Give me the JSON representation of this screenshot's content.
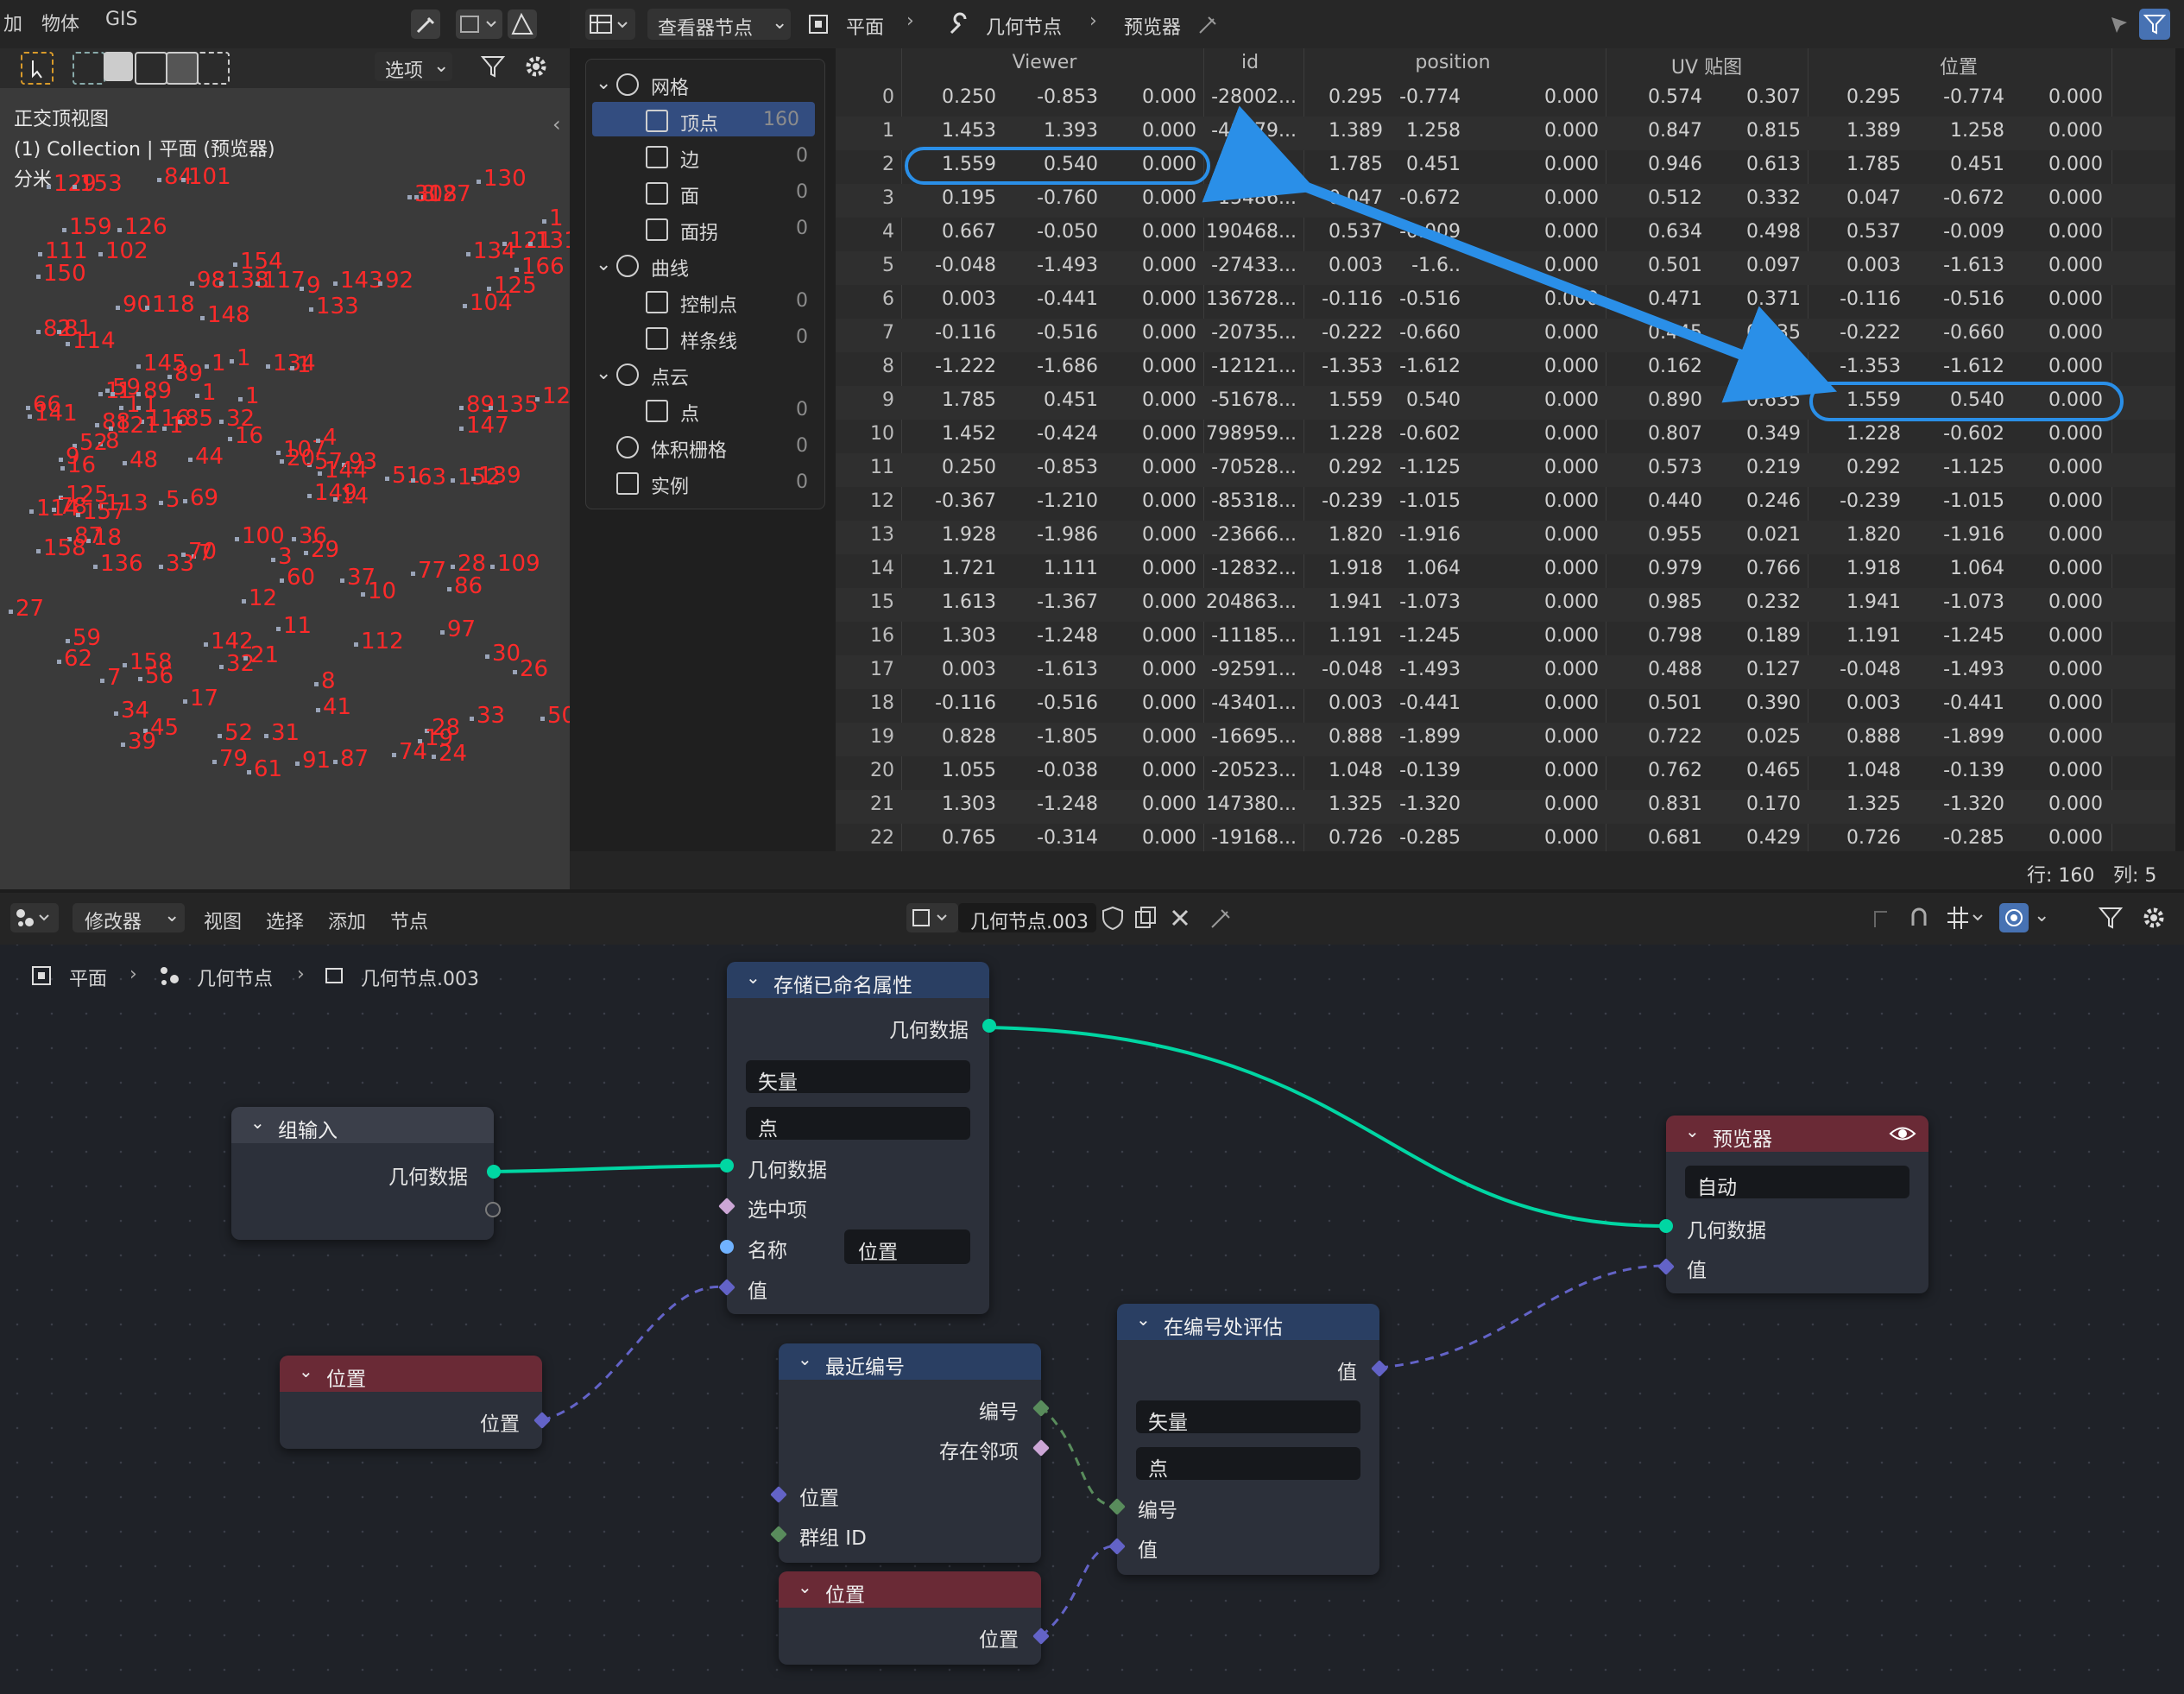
{
  "viewport": {
    "menu": [
      "加",
      "物体",
      "GIS"
    ],
    "options_label": "选项",
    "view_name": "正交顶视图",
    "collection_line": "(1) Collection | 平面 (预览器)",
    "units": "分米",
    "point_labels": [
      "129",
      "153",
      "84",
      "101",
      "130",
      "127",
      "8",
      "308",
      "1",
      "159",
      "126",
      "111",
      "102",
      "134",
      "121",
      "131",
      "150",
      "154",
      "166",
      "98",
      "138",
      "117",
      "143",
      "92",
      "125",
      "104",
      "90",
      "118",
      "148",
      "9",
      "133",
      "82",
      "81",
      "114",
      "145",
      "1",
      "89",
      "1",
      "134",
      "1",
      "59",
      "1",
      "1",
      "89",
      "1",
      "1",
      "89",
      "135",
      "121",
      "66",
      "1",
      "1",
      "88",
      "116",
      "85",
      "32",
      "147",
      "141",
      "121",
      "1",
      "8",
      "52",
      "9",
      "48",
      "44",
      "16",
      "16",
      "107",
      "4",
      "57",
      "51",
      "63",
      "152",
      "139",
      "93",
      "144",
      "125",
      "113",
      "5",
      "20",
      "149",
      "69",
      "78",
      "14",
      "114",
      "157",
      "36",
      "100",
      "18",
      "29",
      "87",
      "158",
      "136",
      "33",
      "7",
      "3",
      "60",
      "70",
      "37",
      "10",
      "77",
      "28",
      "109",
      "12",
      "86",
      "27",
      "11",
      "59",
      "142",
      "112",
      "97",
      "30",
      "62",
      "158",
      "32",
      "21",
      "7",
      "56",
      "26",
      "17",
      "8",
      "41",
      "34",
      "45",
      "52",
      "31",
      "28",
      "33",
      "50",
      "39",
      "79",
      "61",
      "91",
      "87",
      "74",
      "19",
      "24"
    ],
    "colors": {
      "label": "#ff2a2a",
      "bg": "#3a3a3a"
    }
  },
  "spreadsheet": {
    "editor_type_label": "查看器节点",
    "breadcrumb": [
      "平面",
      "几何节点",
      "预览器"
    ],
    "tree": [
      {
        "label": "网格",
        "count": ""
      },
      {
        "label": "顶点",
        "count": "160"
      },
      {
        "label": "边",
        "count": "0"
      },
      {
        "label": "面",
        "count": "0"
      },
      {
        "label": "面拐",
        "count": "0"
      },
      {
        "label": "曲线",
        "count": ""
      },
      {
        "label": "控制点",
        "count": "0"
      },
      {
        "label": "样条线",
        "count": "0"
      },
      {
        "label": "点云",
        "count": ""
      },
      {
        "label": "点",
        "count": "0"
      },
      {
        "label": "体积栅格",
        "count": "0"
      },
      {
        "label": "实例",
        "count": "0"
      }
    ],
    "columns": [
      "Viewer",
      "id",
      "position",
      "UV 贴图",
      "位置"
    ],
    "rows": [
      [
        "0",
        "0.250",
        "-0.853",
        "0.000",
        "-28002...",
        "0.295",
        "-0.774",
        "0.000",
        "0.574",
        "0.307",
        "0.295",
        "-0.774",
        "0.000"
      ],
      [
        "1",
        "1.453",
        "1.393",
        "0.000",
        "-48779...",
        "1.389",
        "1.258",
        "0.000",
        "0.847",
        "0.815",
        "1.389",
        "1.258",
        "0.000"
      ],
      [
        "2",
        "1.559",
        "0.540",
        "0.000",
        "157...",
        "1.785",
        "0.451",
        "0.000",
        "0.946",
        "0.613",
        "1.785",
        "0.451",
        "0.000"
      ],
      [
        "3",
        "0.195",
        "-0.760",
        "0.000",
        "-15486...",
        "0.047",
        "-0.672",
        "0.000",
        "0.512",
        "0.332",
        "0.047",
        "-0.672",
        "0.000"
      ],
      [
        "4",
        "0.667",
        "-0.050",
        "0.000",
        "190468...",
        "0.537",
        "-0.009",
        "0.000",
        "0.634",
        "0.498",
        "0.537",
        "-0.009",
        "0.000"
      ],
      [
        "5",
        "-0.048",
        "-1.493",
        "0.000",
        "-27433...",
        "0.003",
        "-1.6..",
        "0.000",
        "0.501",
        "0.097",
        "0.003",
        "-1.613",
        "0.000"
      ],
      [
        "6",
        "0.003",
        "-0.441",
        "0.000",
        "136728...",
        "-0.116",
        "-0.516",
        "0.000",
        "0.471",
        "0.371",
        "-0.116",
        "-0.516",
        "0.000"
      ],
      [
        "7",
        "-0.116",
        "-0.516",
        "0.000",
        "-20735...",
        "-0.222",
        "-0.660",
        "0.000",
        "0.445",
        "0.335",
        "-0.222",
        "-0.660",
        "0.000"
      ],
      [
        "8",
        "-1.222",
        "-1.686",
        "0.000",
        "-12121...",
        "-1.353",
        "-1.612",
        "0.000",
        "0.162",
        "0.27",
        "-1.353",
        "-1.612",
        "0.000"
      ],
      [
        "9",
        "1.785",
        "0.451",
        "0.000",
        "-51678...",
        "1.559",
        "0.540",
        "0.000",
        "0.890",
        "0.635",
        "1.559",
        "0.540",
        "0.000"
      ],
      [
        "10",
        "1.452",
        "-0.424",
        "0.000",
        "798959...",
        "1.228",
        "-0.602",
        "0.000",
        "0.807",
        "0.349",
        "1.228",
        "-0.602",
        "0.000"
      ],
      [
        "11",
        "0.250",
        "-0.853",
        "0.000",
        "-70528...",
        "0.292",
        "-1.125",
        "0.000",
        "0.573",
        "0.219",
        "0.292",
        "-1.125",
        "0.000"
      ],
      [
        "12",
        "-0.367",
        "-1.210",
        "0.000",
        "-85318...",
        "-0.239",
        "-1.015",
        "0.000",
        "0.440",
        "0.246",
        "-0.239",
        "-1.015",
        "0.000"
      ],
      [
        "13",
        "1.928",
        "-1.986",
        "0.000",
        "-23666...",
        "1.820",
        "-1.916",
        "0.000",
        "0.955",
        "0.021",
        "1.820",
        "-1.916",
        "0.000"
      ],
      [
        "14",
        "1.721",
        "1.111",
        "0.000",
        "-12832...",
        "1.918",
        "1.064",
        "0.000",
        "0.979",
        "0.766",
        "1.918",
        "1.064",
        "0.000"
      ],
      [
        "15",
        "1.613",
        "-1.367",
        "0.000",
        "204863...",
        "1.941",
        "-1.073",
        "0.000",
        "0.985",
        "0.232",
        "1.941",
        "-1.073",
        "0.000"
      ],
      [
        "16",
        "1.303",
        "-1.248",
        "0.000",
        "-11185...",
        "1.191",
        "-1.245",
        "0.000",
        "0.798",
        "0.189",
        "1.191",
        "-1.245",
        "0.000"
      ],
      [
        "17",
        "0.003",
        "-1.613",
        "0.000",
        "-92591...",
        "-0.048",
        "-1.493",
        "0.000",
        "0.488",
        "0.127",
        "-0.048",
        "-1.493",
        "0.000"
      ],
      [
        "18",
        "-0.116",
        "-0.516",
        "0.000",
        "-43401...",
        "0.003",
        "-0.441",
        "0.000",
        "0.501",
        "0.390",
        "0.003",
        "-0.441",
        "0.000"
      ],
      [
        "19",
        "0.828",
        "-1.805",
        "0.000",
        "-16695...",
        "0.888",
        "-1.899",
        "0.000",
        "0.722",
        "0.025",
        "0.888",
        "-1.899",
        "0.000"
      ],
      [
        "20",
        "1.055",
        "-0.038",
        "0.000",
        "-20523...",
        "1.048",
        "-0.139",
        "0.000",
        "0.762",
        "0.465",
        "1.048",
        "-0.139",
        "0.000"
      ],
      [
        "21",
        "1.303",
        "-1.248",
        "0.000",
        "147380...",
        "1.325",
        "-1.320",
        "0.000",
        "0.831",
        "0.170",
        "1.325",
        "-1.320",
        "0.000"
      ],
      [
        "22",
        "0.765",
        "-0.314",
        "0.000",
        "-19168...",
        "0.726",
        "-0.285",
        "0.000",
        "0.681",
        "0.429",
        "0.726",
        "-0.285",
        "0.000"
      ]
    ],
    "status_rows": "行: 160",
    "status_cols": "列: 5",
    "highlight_color": "#2a8fe8"
  },
  "node_editor": {
    "menu": [
      "修改器",
      "视图",
      "选择",
      "添加",
      "节点"
    ],
    "tree_name": "几何节点.003",
    "breadcrumb": [
      "平面",
      "几何节点",
      "几何节点.003"
    ],
    "nodes": {
      "group_input": {
        "title": "组输入",
        "geometry": "几何数据"
      },
      "store_attr": {
        "title": "存储已命名属性",
        "out_geometry": "几何数据",
        "type": "矢量",
        "domain": "点",
        "in_geometry": "几何数据",
        "selection": "选中项",
        "name_label": "名称",
        "name_value": "位置",
        "value": "值"
      },
      "position1": {
        "title": "位置",
        "out": "位置"
      },
      "nearest": {
        "title": "最近编号",
        "index": "编号",
        "has_neighbor": "存在邻项",
        "position": "位置",
        "group_id": "群组 ID"
      },
      "position2": {
        "title": "位置",
        "out": "位置"
      },
      "eval_index": {
        "title": "在编号处评估",
        "value_out": "值",
        "type": "矢量",
        "domain": "点",
        "index": "编号",
        "value": "值"
      },
      "viewer": {
        "title": "预览器",
        "mode": "自动",
        "geometry": "几何数据",
        "value": "值"
      }
    },
    "colors": {
      "geometry_link": "#00d6a3",
      "vector_link": "#6363c7",
      "int_link": "#598c5c",
      "input_header": "#3b3f4a",
      "field_header": "#6a2a36",
      "node_header": "#2a3f63",
      "viewer_header": "#6a2a36"
    }
  }
}
